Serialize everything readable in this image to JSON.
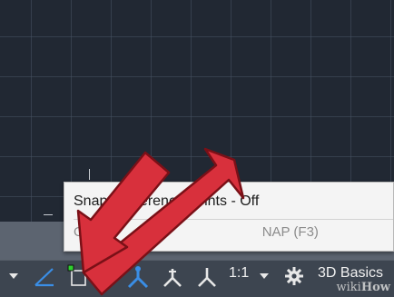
{
  "tooltip": {
    "title": "Snap c          reference points - Off",
    "subtitle_left": "Obje",
    "subtitle_right": "NAP (F3)"
  },
  "statusbar": {
    "scale_label": "1:1",
    "workspace_label": "3D Basics",
    "watermark_prefix": "wiki",
    "watermark_suffix": "How"
  },
  "icons": {
    "polar": "polar-tracking-icon",
    "osnap": "object-snap-icon",
    "annotation": "annotation-visibility-icon",
    "autoscale": "autoscale-icon",
    "annotation_scale": "annotation-scale-icon",
    "settings": "gear-icon"
  },
  "colors": {
    "canvas": "#212833",
    "arrow": "#d8303c",
    "accent_blue": "#3a8ee6",
    "osnap_green": "#2fd12f"
  }
}
